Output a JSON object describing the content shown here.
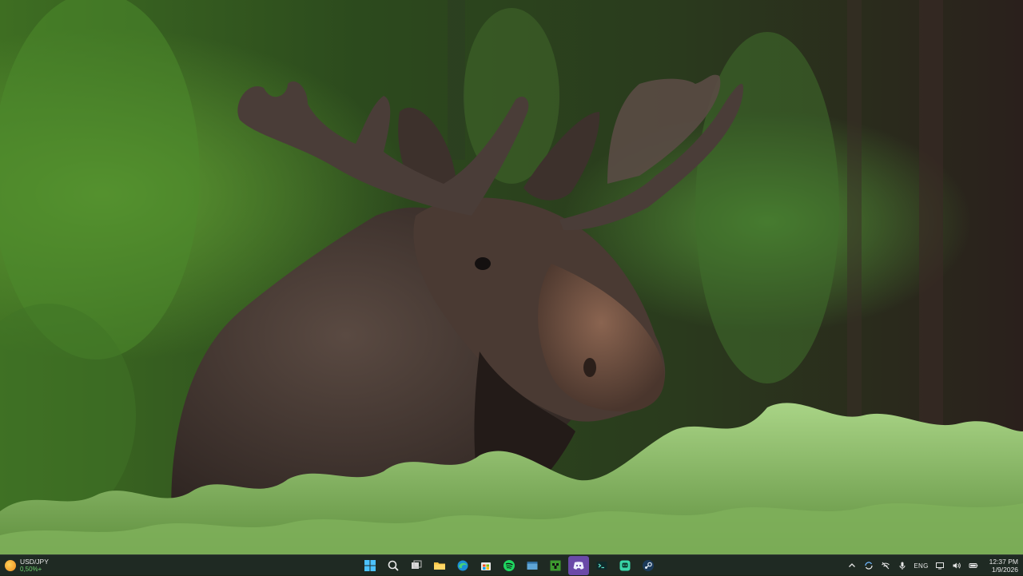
{
  "wallpaper": {
    "subject": "moose-with-velvet-antlers",
    "colors": {
      "forest_dark": "#1d2a18",
      "forest_green": "#4f8a2e",
      "moose_brown": "#3d302a",
      "muzzle": "#6b4e3f",
      "shrub": "#8fc26a"
    }
  },
  "taskbar": {
    "background": "#1f2a23",
    "widget": {
      "title": "USD/JPY",
      "value": "0,50%+",
      "icon": "sun-icon"
    },
    "apps": [
      {
        "name": "start",
        "icon": "windows-logo-icon"
      },
      {
        "name": "search",
        "icon": "search-icon"
      },
      {
        "name": "task-view",
        "icon": "task-view-icon"
      },
      {
        "name": "file-explorer",
        "icon": "folder-icon"
      },
      {
        "name": "edge",
        "icon": "edge-icon"
      },
      {
        "name": "store",
        "icon": "store-icon"
      },
      {
        "name": "spotify",
        "icon": "spotify-icon"
      },
      {
        "name": "app-window",
        "icon": "window-app-icon"
      },
      {
        "name": "minecraft",
        "icon": "minecraft-icon"
      },
      {
        "name": "discord",
        "icon": "discord-icon",
        "active": true
      },
      {
        "name": "terminal",
        "icon": "terminal-icon"
      },
      {
        "name": "chat-app",
        "icon": "chat-app-icon"
      },
      {
        "name": "steam",
        "icon": "steam-icon"
      }
    ],
    "tray": {
      "language": "ENG",
      "time": "12:37 PM",
      "date": "1/9/2026"
    }
  }
}
